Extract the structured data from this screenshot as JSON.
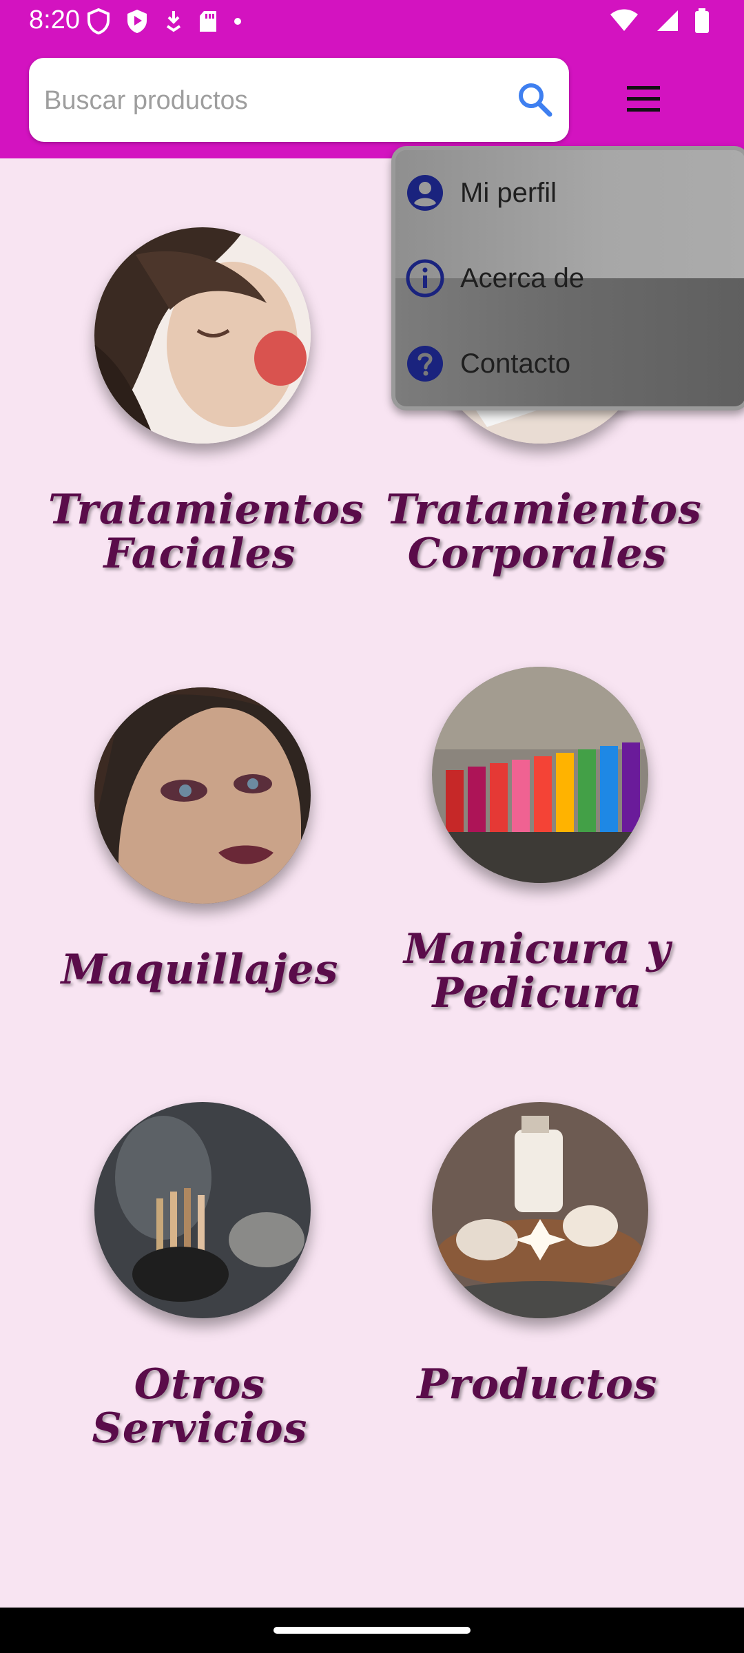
{
  "status_bar": {
    "time": "8:20"
  },
  "search": {
    "placeholder": "Buscar productos"
  },
  "categories": [
    {
      "label_line1": "Tratamientos",
      "label_line2": "Faciales"
    },
    {
      "label_line1": "Tratamientos",
      "label_line2": "Corporales"
    },
    {
      "label_line1": "Maquillajes",
      "label_line2": ""
    },
    {
      "label_line1": "Manicura y",
      "label_line2": "Pedicura"
    },
    {
      "label_line1": "Otros Servicios",
      "label_line2": ""
    },
    {
      "label_line1": "Productos",
      "label_line2": ""
    }
  ],
  "menu": {
    "items": [
      {
        "label": "Mi perfil",
        "icon": "account-circle-icon"
      },
      {
        "label": "Acerca de",
        "icon": "info-icon"
      },
      {
        "label": "Contacto",
        "icon": "help-icon"
      }
    ]
  },
  "colors": {
    "app_bar": "#d313c0",
    "background": "#f8e4f2",
    "label": "#5a0c4a",
    "menu_icon": "#1a237e"
  }
}
